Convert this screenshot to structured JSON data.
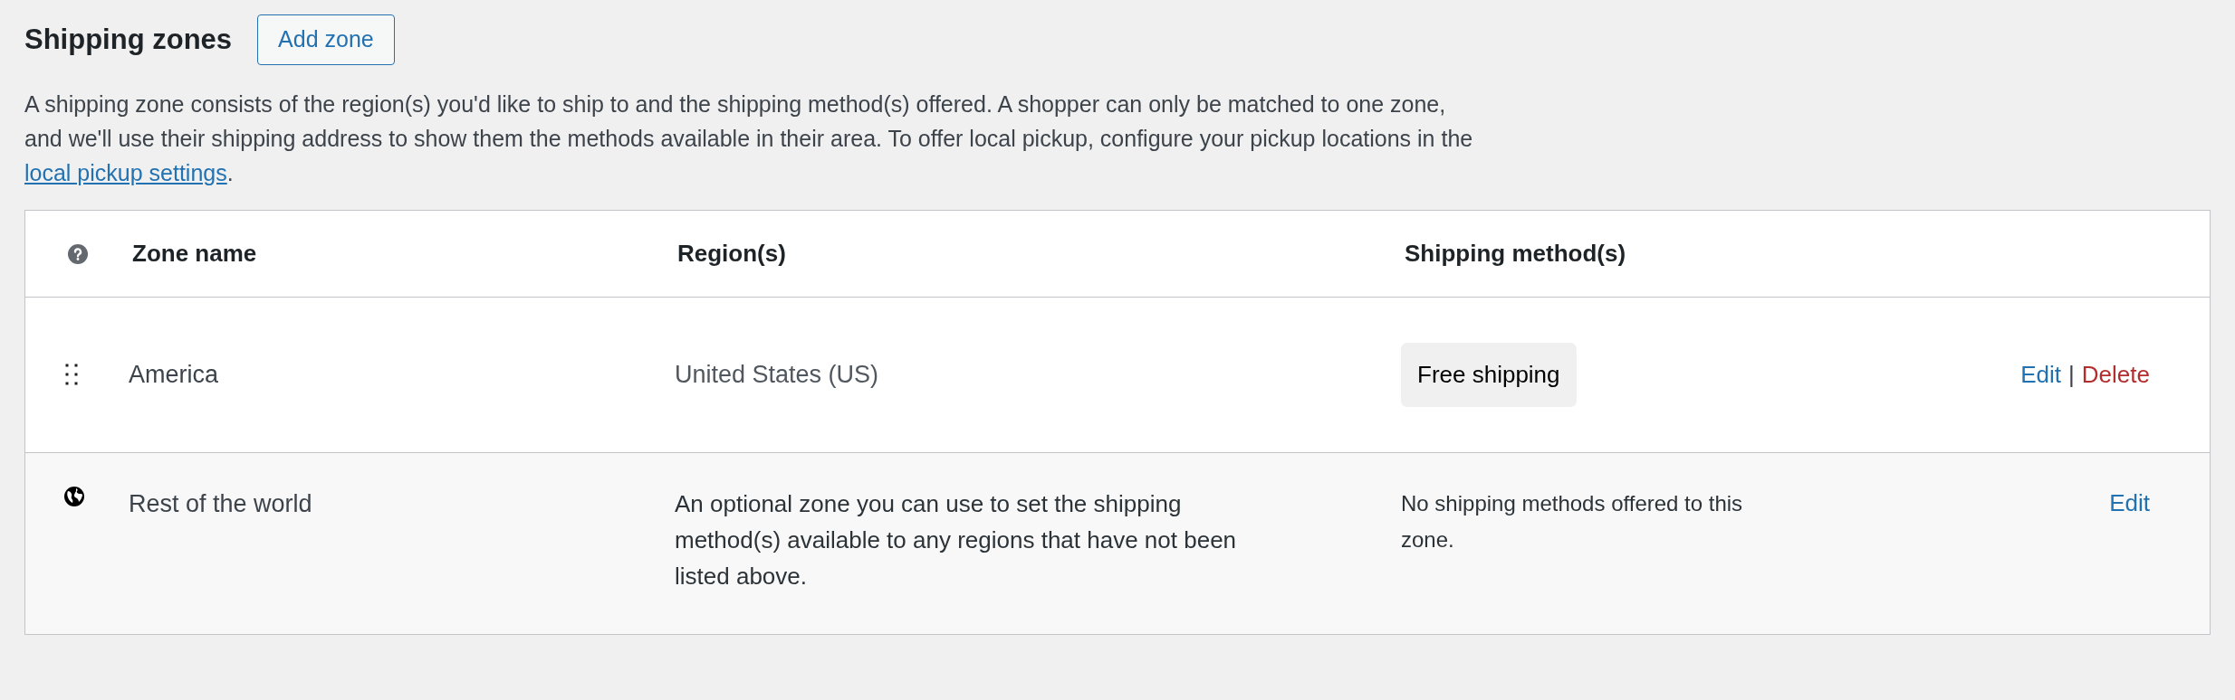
{
  "heading": "Shipping zones",
  "add_button": "Add zone",
  "description": {
    "text": "A shipping zone consists of the region(s) you'd like to ship to and the shipping method(s) offered. A shopper can only be matched to one zone, and we'll use their shipping address to show them the methods available in their area. To offer local pickup, configure your pickup locations in the ",
    "link": "local pickup settings",
    "end": "."
  },
  "table": {
    "columns": [
      "Zone name",
      "Region(s)",
      "Shipping method(s)"
    ],
    "rows": [
      {
        "kind": "zone",
        "name": "America",
        "region": "United States (US)",
        "methods": [
          {
            "kind": "chip",
            "text": "Free shipping"
          }
        ],
        "actions": [
          {
            "kind": "edit",
            "text": "Edit"
          },
          {
            "kind": "separator",
            "text": "|"
          },
          {
            "kind": "delete",
            "text": "Delete"
          }
        ]
      },
      {
        "kind": "rest",
        "name": "Rest of the world",
        "region": "An optional zone you can use to set the shipping method(s) available to any regions that have not been listed above.",
        "methods": [
          {
            "kind": "note",
            "text": "No shipping methods offered to this zone."
          }
        ],
        "actions": [
          {
            "kind": "edit",
            "text": "Edit"
          }
        ]
      }
    ]
  }
}
